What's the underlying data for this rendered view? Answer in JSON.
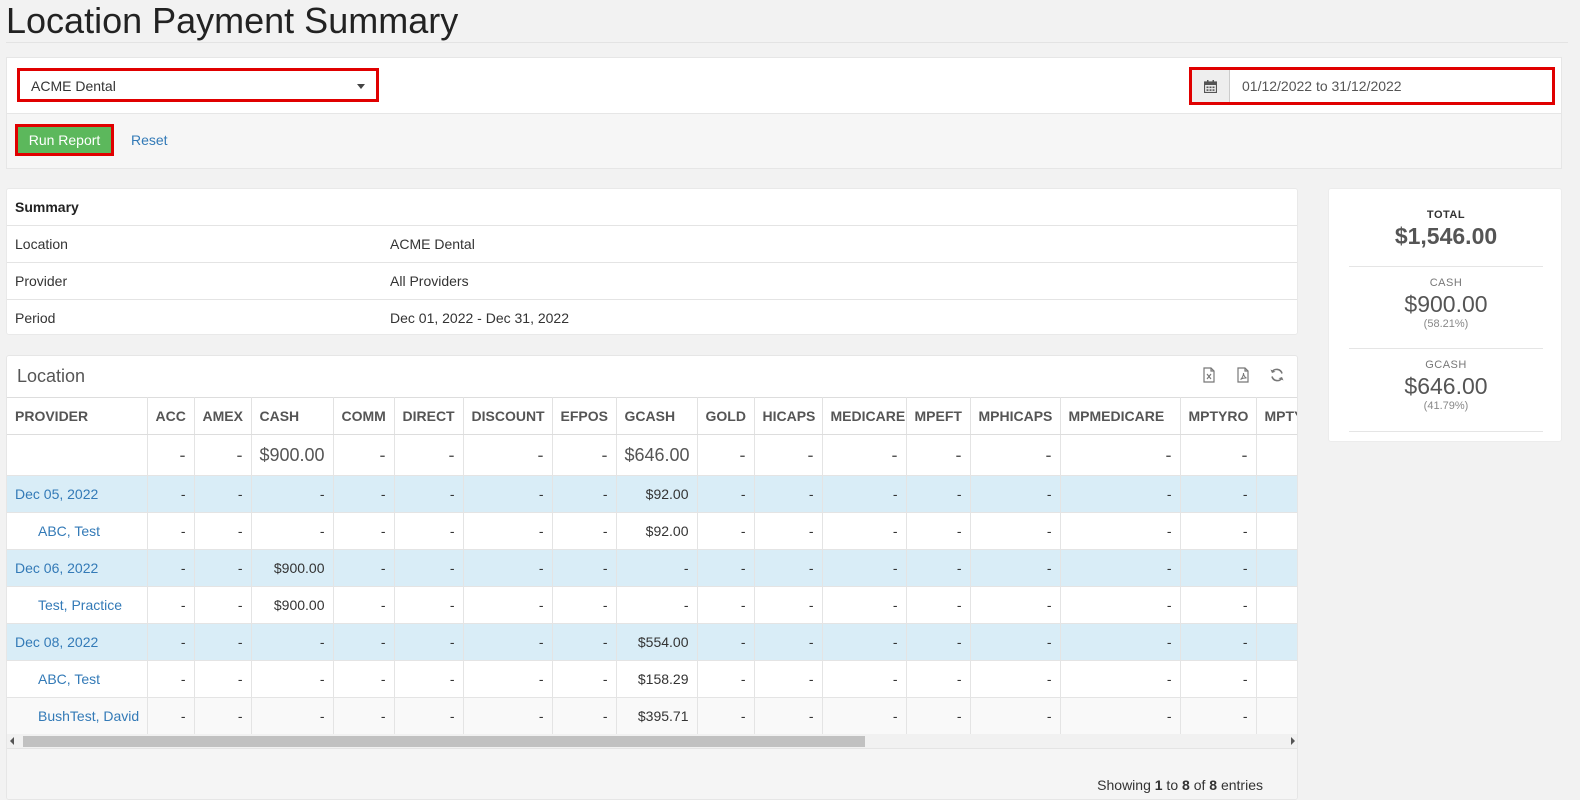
{
  "page": {
    "title": "Location Payment Summary"
  },
  "filters": {
    "location": "ACME Dental",
    "date_range": "01/12/2022 to 31/12/2022",
    "run_label": "Run Report",
    "reset_label": "Reset"
  },
  "summary": {
    "heading": "Summary",
    "rows": [
      {
        "key": "Location",
        "value": "ACME Dental"
      },
      {
        "key": "Provider",
        "value": "All Providers"
      },
      {
        "key": "Period",
        "value": "Dec 01, 2022 - Dec 31, 2022"
      }
    ]
  },
  "totals": {
    "total_label": "TOTAL",
    "total_amount": "$1,546.00",
    "cash_label": "CASH",
    "cash_amount": "$900.00",
    "cash_pct": "(58.21%)",
    "gcash_label": "GCASH",
    "gcash_amount": "$646.00",
    "gcash_pct": "(41.79%)"
  },
  "location_table": {
    "title": "Location",
    "columns": [
      "PROVIDER",
      "ACC",
      "AMEX",
      "CASH",
      "COMM",
      "DIRECT",
      "DISCOUNT",
      "EFPOS",
      "GCASH",
      "GOLD",
      "HICAPS",
      "MEDICARE",
      "MPEFT",
      "MPHICAPS",
      "MPMEDICARE",
      "MPTYRO",
      "MPTYRO"
    ],
    "total_row": [
      "",
      "-",
      "-",
      "$900.00",
      "-",
      "-",
      "-",
      "-",
      "$646.00",
      "-",
      "-",
      "-",
      "-",
      "-",
      "-",
      "-",
      ""
    ],
    "rows": [
      {
        "type": "date",
        "cells": [
          "Dec 05, 2022",
          "-",
          "-",
          "-",
          "-",
          "-",
          "-",
          "-",
          "$92.00",
          "-",
          "-",
          "-",
          "-",
          "-",
          "-",
          "-",
          ""
        ]
      },
      {
        "type": "provider",
        "cells": [
          "ABC, Test",
          "-",
          "-",
          "-",
          "-",
          "-",
          "-",
          "-",
          "$92.00",
          "-",
          "-",
          "-",
          "-",
          "-",
          "-",
          "-",
          ""
        ]
      },
      {
        "type": "date",
        "cells": [
          "Dec 06, 2022",
          "-",
          "-",
          "$900.00",
          "-",
          "-",
          "-",
          "-",
          "-",
          "-",
          "-",
          "-",
          "-",
          "-",
          "-",
          "-",
          ""
        ]
      },
      {
        "type": "provider",
        "cells": [
          "Test, Practice",
          "-",
          "-",
          "$900.00",
          "-",
          "-",
          "-",
          "-",
          "-",
          "-",
          "-",
          "-",
          "-",
          "-",
          "-",
          "-",
          ""
        ]
      },
      {
        "type": "date",
        "cells": [
          "Dec 08, 2022",
          "-",
          "-",
          "-",
          "-",
          "-",
          "-",
          "-",
          "$554.00",
          "-",
          "-",
          "-",
          "-",
          "-",
          "-",
          "-",
          ""
        ]
      },
      {
        "type": "provider",
        "cells": [
          "ABC, Test",
          "-",
          "-",
          "-",
          "-",
          "-",
          "-",
          "-",
          "$158.29",
          "-",
          "-",
          "-",
          "-",
          "-",
          "-",
          "-",
          ""
        ]
      },
      {
        "type": "provider",
        "cells": [
          "BushTest, David",
          "-",
          "-",
          "-",
          "-",
          "-",
          "-",
          "-",
          "$395.71",
          "-",
          "-",
          "-",
          "-",
          "-",
          "-",
          "-",
          ""
        ]
      }
    ],
    "entries_prefix": "Showing ",
    "entries_from": "1",
    "entries_mid1": " to ",
    "entries_to": "8",
    "entries_mid2": " of ",
    "entries_total": "8",
    "entries_suffix": " entries"
  },
  "icons": {
    "calendar": "calendar-icon",
    "excel": "excel-export-icon",
    "pdf": "pdf-export-icon",
    "refresh": "refresh-icon",
    "caret": "chevron-down-icon"
  },
  "colors": {
    "accent_red": "#e00000",
    "run_green": "#5cb85c",
    "link_blue": "#337ab7",
    "date_row_bg": "#d9edf7"
  }
}
